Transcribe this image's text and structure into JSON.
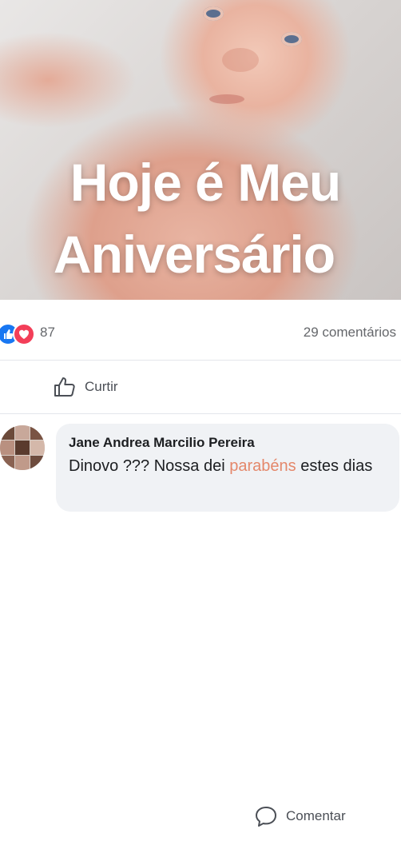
{
  "post": {
    "caption_line1": "Hoje é Meu",
    "caption_line2": "Aniversário"
  },
  "reactions": {
    "icons": [
      "like-icon",
      "heart-icon"
    ],
    "count": "87",
    "comments_count": "29 comentários"
  },
  "actions": {
    "like_label": "Curtir",
    "comment_label": "Comentar"
  },
  "comment": {
    "author": "Jane Andrea Marcilio Pereira",
    "text_before": "Dinovo ??? Nossa dei ",
    "text_highlight": "parabéns",
    "text_after": " estes dias"
  },
  "colors": {
    "like_blue": "#1877f2",
    "heart_red": "#f33e58",
    "highlight": "#e4876a"
  }
}
